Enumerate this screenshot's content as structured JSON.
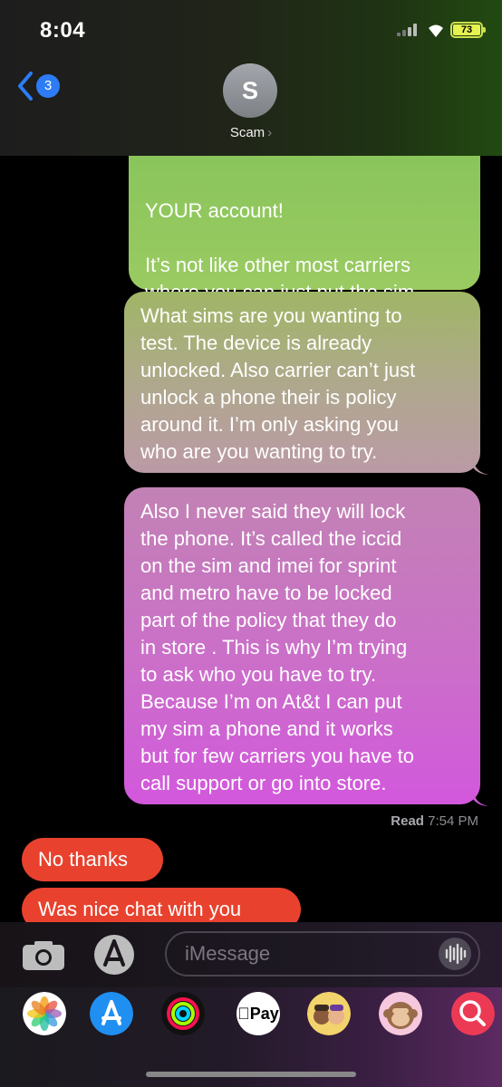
{
  "status_bar": {
    "time": "8:04",
    "battery": "73"
  },
  "header": {
    "back_count": "3",
    "avatar_initial": "S",
    "contact_name": "Scam",
    "contact_chevron": "›"
  },
  "messages": {
    "m1_partial": "YOUR account!\n\nIt’s not like other most carriers\nwhere you can just put the sim\nin",
    "m2": "What sims are you wanting to\ntest. The device is already\nunlocked. Also carrier can’t just\nunlock a phone their is policy\naround it. I’m only asking you\nwho are you wanting to try.",
    "m3": "Also I never said they will lock\nthe phone. It’s called the iccid\non the sim and imei for sprint\nand metro have to be locked\npart of the policy that they do\nin store . This is why I’m trying\nto ask who you have to try.\nBecause I’m on At&t I can put\nmy sim a phone and it works\nbut for few carriers you have to\ncall support or go into store.",
    "read_label": "Read",
    "read_time": "7:54 PM",
    "reply1": "No thanks",
    "reply2": "Was nice chat with you"
  },
  "input": {
    "placeholder": "iMessage"
  },
  "app_drawer": {
    "apps": [
      "photos-icon",
      "app-store-icon",
      "activity-icon",
      "apple-pay-icon",
      "memoji-icon",
      "animoji-icon",
      "search-images-icon"
    ],
    "apple_pay_label": "Pay"
  },
  "colors": {
    "sent_green": "#87c45a",
    "sent_pink": "#d258dc",
    "received_red": "#e8422e",
    "badge_blue": "#2d7cf6"
  }
}
